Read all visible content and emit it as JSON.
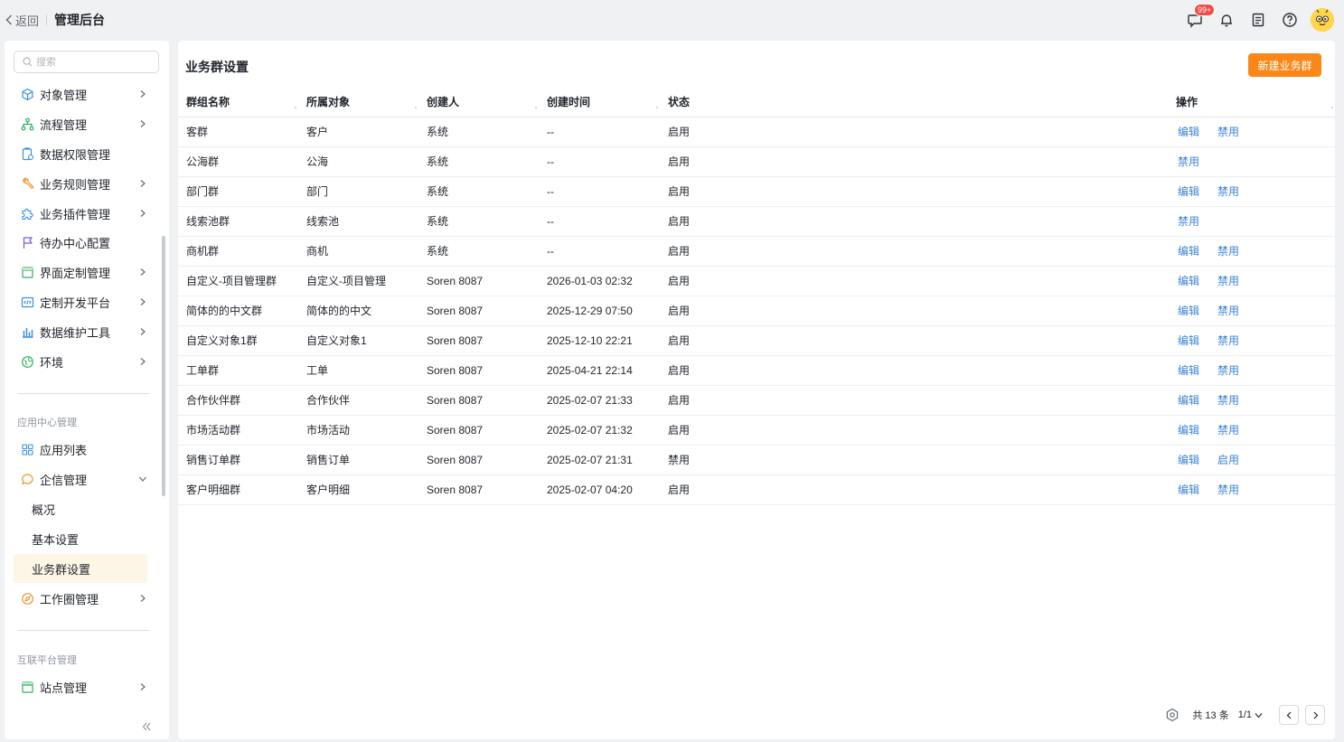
{
  "header": {
    "back_label": "返回",
    "title": "管理后台",
    "badge": "99+"
  },
  "sidebar": {
    "search_placeholder": "搜索",
    "items": [
      {
        "label": "对象管理",
        "icon": "cube-icon"
      },
      {
        "label": "流程管理",
        "icon": "flow-icon"
      },
      {
        "label": "数据权限管理",
        "icon": "clipboard-lock-icon"
      },
      {
        "label": "业务规则管理",
        "icon": "wrench-icon"
      },
      {
        "label": "业务插件管理",
        "icon": "puzzle-icon"
      },
      {
        "label": "待办中心配置",
        "icon": "flag-icon"
      },
      {
        "label": "界面定制管理",
        "icon": "layout-icon"
      },
      {
        "label": "定制开发平台",
        "icon": "code-icon"
      },
      {
        "label": "数据维护工具",
        "icon": "bar-chart-icon"
      },
      {
        "label": "环境",
        "icon": "globe-icon"
      }
    ],
    "section1": "应用中心管理",
    "app_items": [
      {
        "label": "应用列表",
        "icon": "grid-icon"
      },
      {
        "label": "企信管理",
        "icon": "chat-bubble-icon"
      }
    ],
    "sub_items": [
      "概况",
      "基本设置",
      "业务群设置"
    ],
    "work_item": "工作圈管理",
    "section2": "互联平台管理",
    "site_item": "站点管理"
  },
  "main": {
    "title": "业务群设置",
    "new_button": "新建业务群",
    "columns": [
      "群组名称",
      "所属对象",
      "创建人",
      "创建时间",
      "状态",
      "操作"
    ],
    "rows": [
      {
        "name": "客群",
        "object": "客户",
        "creator": "系统",
        "time": "--",
        "status": "启用",
        "ops": [
          "编辑",
          "禁用"
        ]
      },
      {
        "name": "公海群",
        "object": "公海",
        "creator": "系统",
        "time": "--",
        "status": "启用",
        "ops": [
          "禁用"
        ]
      },
      {
        "name": "部门群",
        "object": "部门",
        "creator": "系统",
        "time": "--",
        "status": "启用",
        "ops": [
          "编辑",
          "禁用"
        ]
      },
      {
        "name": "线索池群",
        "object": "线索池",
        "creator": "系统",
        "time": "--",
        "status": "启用",
        "ops": [
          "禁用"
        ]
      },
      {
        "name": "商机群",
        "object": "商机",
        "creator": "系统",
        "time": "--",
        "status": "启用",
        "ops": [
          "编辑",
          "禁用"
        ]
      },
      {
        "name": "自定义-项目管理群",
        "object": "自定义-项目管理",
        "creator": "Soren 8087",
        "time": "2026-01-03 02:32",
        "status": "启用",
        "ops": [
          "编辑",
          "禁用"
        ]
      },
      {
        "name": "简体的的中文群",
        "object": "简体的的中文",
        "creator": "Soren 8087",
        "time": "2025-12-29 07:50",
        "status": "启用",
        "ops": [
          "编辑",
          "禁用"
        ]
      },
      {
        "name": "自定义对象1群",
        "object": "自定义对象1",
        "creator": "Soren 8087",
        "time": "2025-12-10 22:21",
        "status": "启用",
        "ops": [
          "编辑",
          "禁用"
        ]
      },
      {
        "name": "工单群",
        "object": "工单",
        "creator": "Soren 8087",
        "time": "2025-04-21 22:14",
        "status": "启用",
        "ops": [
          "编辑",
          "禁用"
        ]
      },
      {
        "name": "合作伙伴群",
        "object": "合作伙伴",
        "creator": "Soren 8087",
        "time": "2025-02-07 21:33",
        "status": "启用",
        "ops": [
          "编辑",
          "禁用"
        ]
      },
      {
        "name": "市场活动群",
        "object": "市场活动",
        "creator": "Soren 8087",
        "time": "2025-02-07 21:32",
        "status": "启用",
        "ops": [
          "编辑",
          "禁用"
        ]
      },
      {
        "name": "销售订单群",
        "object": "销售订单",
        "creator": "Soren 8087",
        "time": "2025-02-07 21:31",
        "status": "禁用",
        "ops": [
          "编辑",
          "启用"
        ]
      },
      {
        "name": "客户明细群",
        "object": "客户明细",
        "creator": "Soren 8087",
        "time": "2025-02-07 04:20",
        "status": "启用",
        "ops": [
          "编辑",
          "禁用"
        ]
      }
    ]
  },
  "pager": {
    "total": "共 13 条",
    "page": "1/1"
  },
  "colors": {
    "accent": "#fa8717",
    "link": "#3b82d6",
    "active_bg": "#fdf5e6"
  }
}
